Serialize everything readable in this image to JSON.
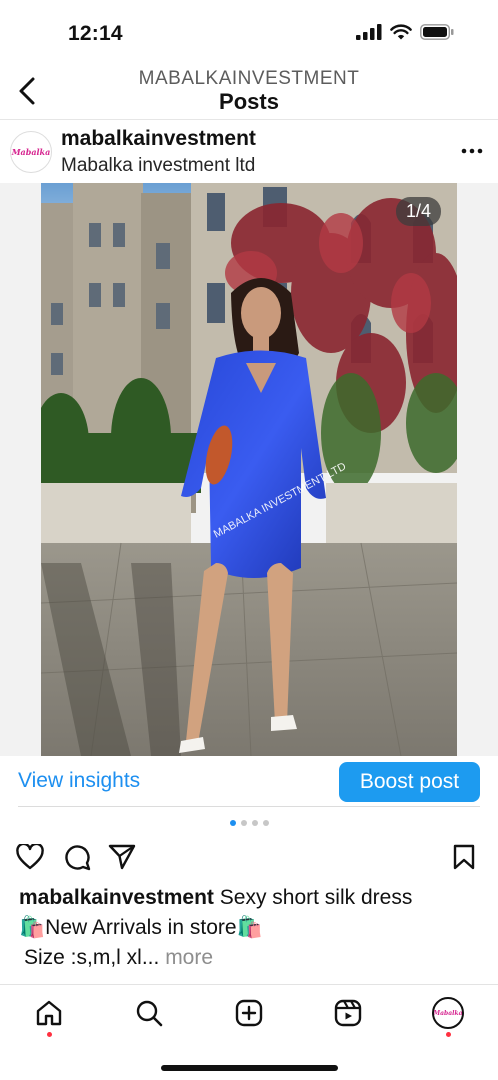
{
  "status_bar": {
    "time": "12:14"
  },
  "header": {
    "account_caps": "MABALKAINVESTMENT",
    "title": "Posts"
  },
  "post": {
    "avatar_text": "Mabalka",
    "username": "mabalkainvestment",
    "subtitle": "Mabalka investment ltd",
    "counter": "1/4",
    "watermark": "MABALKA INVESTMENT LTD",
    "image_description_icon": "photo-woman-blue-dress",
    "carousel": {
      "count": 4,
      "active_index": 0
    }
  },
  "insights": {
    "view_label": "View insights",
    "boost_label": "Boost post"
  },
  "caption": {
    "username": "mabalkainvestment",
    "line1": " Sexy short silk dress",
    "line2_emoji_left": "🛍️",
    "line2_text": "New Arrivals in store",
    "line2_emoji_right": "🛍️",
    "line3_text": "Size :s,m,l xl...",
    "more_label": " more"
  },
  "colors": {
    "accent": "#1d9bf0",
    "notification_dot": "#ff3040",
    "avatar_brand": "#d6248f"
  },
  "tab_bar": {
    "profile_avatar_text": "Mabalka"
  }
}
